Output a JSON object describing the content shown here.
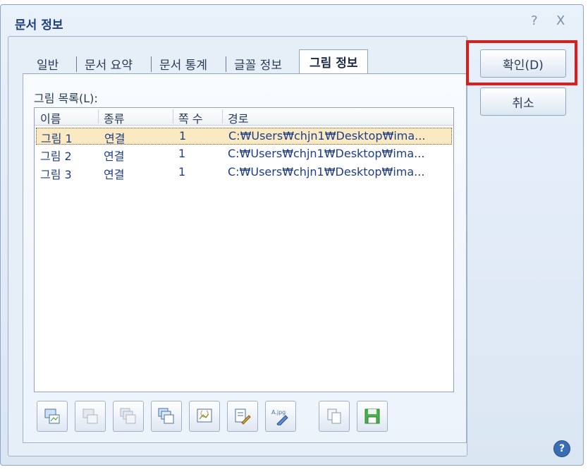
{
  "window": {
    "title": "문서 정보",
    "help_icon": "?",
    "close_icon": "X"
  },
  "tabs": [
    {
      "label": "일반"
    },
    {
      "label": "문서 요약"
    },
    {
      "label": "문서 통계"
    },
    {
      "label": "글꼴 정보"
    },
    {
      "label": "그림 정보",
      "active": true
    }
  ],
  "list": {
    "label": "그림 목록(L):",
    "columns": [
      "이름",
      "종류",
      "쪽 수",
      "경로"
    ],
    "rows": [
      [
        "그림 1",
        "연결",
        "1",
        "C:₩Users₩chjn1₩Desktop₩ima..."
      ],
      [
        "그림 2",
        "연결",
        "1",
        "C:₩Users₩chjn1₩Desktop₩ima..."
      ],
      [
        "그림 3",
        "연결",
        "1",
        "C:₩Users₩chjn1₩Desktop₩ima..."
      ]
    ]
  },
  "buttons": {
    "ok": "확인(D)",
    "cancel": "취소"
  },
  "toolbar": [
    {
      "icon": "image-link-icon",
      "enabled": true
    },
    {
      "icon": "image-embed-icon",
      "enabled": false
    },
    {
      "icon": "image-save-all-icon",
      "enabled": false
    },
    {
      "icon": "image-replace-icon",
      "enabled": true
    },
    {
      "icon": "image-refresh-icon",
      "enabled": true
    },
    {
      "icon": "image-edit-path-icon",
      "enabled": true
    },
    {
      "icon": "jpg-convert-icon",
      "enabled": true
    },
    {
      "icon": "copy-icon",
      "enabled": true
    },
    {
      "icon": "save-icon",
      "enabled": true
    }
  ],
  "help_bottom": "?",
  "colors": {
    "highlight": "#e11a1a",
    "selected_row": "#fbe9c2",
    "text_blue": "#1e3e8a"
  }
}
